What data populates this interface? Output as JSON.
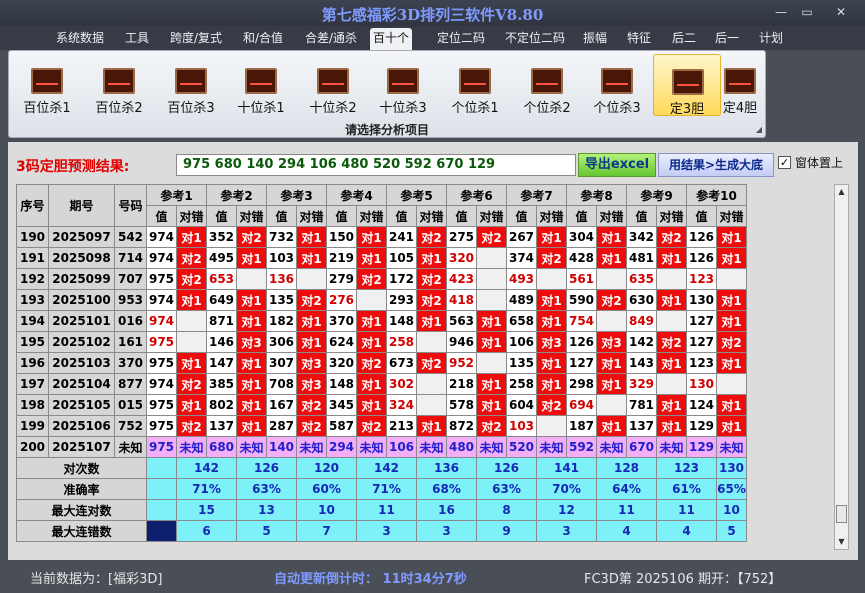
{
  "app": {
    "title": "第七感福彩3D排列三软件V8.80"
  },
  "window_controls": [
    "—",
    "▭",
    "✕"
  ],
  "menu": [
    "系统数据",
    "工具",
    "跨度/复式",
    "和/合值",
    "合差/通杀",
    "百十个",
    "定位二码",
    "不定位二码",
    "振幅",
    "特征",
    "后二",
    "后一",
    "计划"
  ],
  "menu_active_index": 5,
  "ribbon": {
    "buttons": [
      "百位杀1",
      "百位杀2",
      "百位杀3",
      "十位杀1",
      "十位杀2",
      "十位杀3",
      "个位杀1",
      "个位杀2",
      "个位杀3",
      "定3胆",
      "定4胆"
    ],
    "active_index": 9,
    "caption": "请选择分析项目"
  },
  "result": {
    "label": "3码定胆预测结果:",
    "value": "975  680  140  294  106  480  520  592  670  129",
    "export_label": "导出excel",
    "generate_label": "用结果>生成大底",
    "pin_label": "窗体置上",
    "pin_checked": true,
    "pin_mark": "✓"
  },
  "table": {
    "headers": {
      "seq": "序号",
      "issue": "期号",
      "code": "号码",
      "val": "值",
      "mark": "对错"
    },
    "refs": [
      "参考1",
      "参考2",
      "参考3",
      "参考4",
      "参考5",
      "参考6",
      "参考7",
      "参考8",
      "参考9",
      "参考10"
    ],
    "rows": [
      {
        "seq": "190",
        "issue": "2025097",
        "code": "542",
        "cells": [
          [
            "974",
            "对1",
            false
          ],
          [
            "352",
            "对2",
            false
          ],
          [
            "732",
            "对1",
            false
          ],
          [
            "150",
            "对1",
            false
          ],
          [
            "241",
            "对2",
            false
          ],
          [
            "275",
            "对2",
            false
          ],
          [
            "267",
            "对1",
            false
          ],
          [
            "304",
            "对1",
            false
          ],
          [
            "342",
            "对2",
            false
          ],
          [
            "126",
            "对1",
            false
          ]
        ]
      },
      {
        "seq": "191",
        "issue": "2025098",
        "code": "714",
        "cells": [
          [
            "974",
            "对2",
            false
          ],
          [
            "495",
            "对1",
            false
          ],
          [
            "103",
            "对1",
            false
          ],
          [
            "219",
            "对1",
            false
          ],
          [
            "105",
            "对1",
            false
          ],
          [
            "320",
            "",
            true
          ],
          [
            "374",
            "对2",
            false
          ],
          [
            "428",
            "对1",
            false
          ],
          [
            "481",
            "对1",
            false
          ],
          [
            "126",
            "对1",
            false
          ]
        ]
      },
      {
        "seq": "192",
        "issue": "2025099",
        "code": "707",
        "cells": [
          [
            "975",
            "对2",
            false
          ],
          [
            "653",
            "",
            true
          ],
          [
            "136",
            "",
            true
          ],
          [
            "279",
            "对2",
            false
          ],
          [
            "172",
            "对2",
            false
          ],
          [
            "423",
            "",
            true
          ],
          [
            "493",
            "",
            true
          ],
          [
            "561",
            "",
            true
          ],
          [
            "635",
            "",
            true
          ],
          [
            "123",
            "",
            true
          ]
        ]
      },
      {
        "seq": "193",
        "issue": "2025100",
        "code": "953",
        "cells": [
          [
            "974",
            "对1",
            false
          ],
          [
            "649",
            "对1",
            false
          ],
          [
            "135",
            "对2",
            false
          ],
          [
            "276",
            "",
            true
          ],
          [
            "293",
            "对2",
            false
          ],
          [
            "418",
            "",
            true
          ],
          [
            "489",
            "对1",
            false
          ],
          [
            "590",
            "对2",
            false
          ],
          [
            "630",
            "对1",
            false
          ],
          [
            "130",
            "对1",
            false
          ]
        ]
      },
      {
        "seq": "194",
        "issue": "2025101",
        "code": "016",
        "cells": [
          [
            "974",
            "",
            true
          ],
          [
            "871",
            "对1",
            false
          ],
          [
            "182",
            "对1",
            false
          ],
          [
            "370",
            "对1",
            false
          ],
          [
            "148",
            "对1",
            false
          ],
          [
            "563",
            "对1",
            false
          ],
          [
            "658",
            "对1",
            false
          ],
          [
            "754",
            "",
            true
          ],
          [
            "849",
            "",
            true
          ],
          [
            "127",
            "对1",
            false
          ]
        ]
      },
      {
        "seq": "195",
        "issue": "2025102",
        "code": "161",
        "cells": [
          [
            "975",
            "",
            true
          ],
          [
            "146",
            "对3",
            false
          ],
          [
            "306",
            "对1",
            false
          ],
          [
            "624",
            "对1",
            false
          ],
          [
            "258",
            "",
            true
          ],
          [
            "946",
            "对1",
            false
          ],
          [
            "106",
            "对3",
            false
          ],
          [
            "126",
            "对3",
            false
          ],
          [
            "142",
            "对2",
            false
          ],
          [
            "127",
            "对2",
            false
          ]
        ]
      },
      {
        "seq": "196",
        "issue": "2025103",
        "code": "370",
        "cells": [
          [
            "975",
            "对1",
            false
          ],
          [
            "147",
            "对1",
            false
          ],
          [
            "307",
            "对3",
            false
          ],
          [
            "320",
            "对2",
            false
          ],
          [
            "673",
            "对2",
            false
          ],
          [
            "952",
            "",
            true
          ],
          [
            "135",
            "对1",
            false
          ],
          [
            "127",
            "对1",
            false
          ],
          [
            "143",
            "对1",
            false
          ],
          [
            "123",
            "对1",
            false
          ]
        ]
      },
      {
        "seq": "197",
        "issue": "2025104",
        "code": "877",
        "cells": [
          [
            "974",
            "对2",
            false
          ],
          [
            "385",
            "对1",
            false
          ],
          [
            "708",
            "对3",
            false
          ],
          [
            "148",
            "对1",
            false
          ],
          [
            "302",
            "",
            true
          ],
          [
            "218",
            "对1",
            false
          ],
          [
            "258",
            "对1",
            false
          ],
          [
            "298",
            "对1",
            false
          ],
          [
            "329",
            "",
            true
          ],
          [
            "130",
            "",
            true
          ]
        ]
      },
      {
        "seq": "198",
        "issue": "2025105",
        "code": "015",
        "cells": [
          [
            "975",
            "对1",
            false
          ],
          [
            "802",
            "对1",
            false
          ],
          [
            "167",
            "对2",
            false
          ],
          [
            "345",
            "对1",
            false
          ],
          [
            "324",
            "",
            true
          ],
          [
            "578",
            "对1",
            false
          ],
          [
            "604",
            "对2",
            false
          ],
          [
            "694",
            "",
            true
          ],
          [
            "781",
            "对1",
            false
          ],
          [
            "124",
            "对1",
            false
          ]
        ]
      },
      {
        "seq": "199",
        "issue": "2025106",
        "code": "752",
        "cells": [
          [
            "975",
            "对2",
            false
          ],
          [
            "137",
            "对1",
            false
          ],
          [
            "287",
            "对2",
            false
          ],
          [
            "587",
            "对2",
            false
          ],
          [
            "213",
            "对1",
            false
          ],
          [
            "872",
            "对2",
            false
          ],
          [
            "103",
            "",
            true
          ],
          [
            "187",
            "对1",
            false
          ],
          [
            "137",
            "对1",
            false
          ],
          [
            "129",
            "对1",
            false
          ]
        ]
      }
    ],
    "prediction": {
      "seq": "200",
      "issue": "2025107",
      "code": "未知",
      "cells": [
        [
          "975",
          "未知"
        ],
        [
          "680",
          "未知"
        ],
        [
          "140",
          "未知"
        ],
        [
          "294",
          "未知"
        ],
        [
          "106",
          "未知"
        ],
        [
          "480",
          "未知"
        ],
        [
          "520",
          "未知"
        ],
        [
          "592",
          "未知"
        ],
        [
          "670",
          "未知"
        ],
        [
          "129",
          "未知"
        ]
      ]
    },
    "stats": [
      {
        "label": "对次数",
        "values": [
          "142",
          "126",
          "120",
          "142",
          "136",
          "126",
          "141",
          "128",
          "123",
          "130"
        ]
      },
      {
        "label": "准确率",
        "values": [
          "71%",
          "63%",
          "60%",
          "71%",
          "68%",
          "63%",
          "70%",
          "64%",
          "61%",
          "65%"
        ]
      },
      {
        "label": "最大连对数",
        "values": [
          "15",
          "13",
          "10",
          "11",
          "16",
          "8",
          "12",
          "11",
          "11",
          "10"
        ]
      },
      {
        "label": "最大连错数",
        "values": [
          "6",
          "5",
          "7",
          "3",
          "3",
          "9",
          "3",
          "4",
          "4",
          "5"
        ]
      }
    ]
  },
  "status": {
    "current_data": "当前数据为：[福彩3D]",
    "countdown": "自动更新倒计时：  11时34分7秒",
    "issue_info": "FC3D第 2025106 期开：【752】"
  },
  "colors": {
    "hit": "#ee0c0c",
    "miss_text": "#d00000",
    "stats_bg": "#7ef0f8",
    "prediction_bg": "#f4aef8",
    "title": "#7f9bff"
  }
}
